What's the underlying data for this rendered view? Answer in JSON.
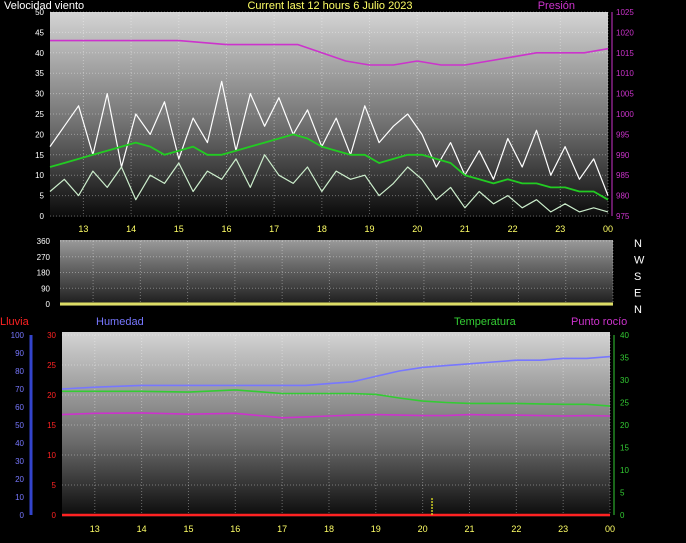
{
  "header": {
    "left_label": "Velocidad viento",
    "title": "Current last 12 hours 6 Julio 2023",
    "right_label": "Presión"
  },
  "colors": {
    "gust": "#ffffff",
    "wind_avg": "#22cc22",
    "wind_light": "#cceecc",
    "pressure": "#cc33cc",
    "direction_axis": "#dddd66",
    "humidity": "#7777ff",
    "temperature": "#33cc33",
    "dew_point": "#cc33cc",
    "rain": "#ff2222",
    "rain_axis": "#3344cc",
    "rain_event": "#cccc22",
    "xtick": "#ffff66"
  },
  "chart_data": [
    {
      "type": "line",
      "name": "wind-pressure",
      "x_ticks": [
        "13",
        "14",
        "15",
        "16",
        "17",
        "18",
        "19",
        "20",
        "21",
        "22",
        "23",
        "00"
      ],
      "y_left_ticks": [
        0,
        5,
        10,
        15,
        20,
        25,
        30,
        35,
        40,
        45,
        50
      ],
      "y_right_ticks": [
        975,
        980,
        985,
        990,
        995,
        1000,
        1005,
        1010,
        1015,
        1020,
        1025
      ],
      "ylim_left": [
        0,
        50
      ],
      "ylim_right": [
        975,
        1025
      ],
      "series": [
        {
          "key": "gust",
          "axis": "left",
          "x": [
            12.3,
            12.6,
            12.9,
            13.2,
            13.5,
            13.8,
            14.1,
            14.4,
            14.7,
            15.0,
            15.3,
            15.6,
            15.9,
            16.2,
            16.5,
            16.8,
            17.1,
            17.4,
            17.7,
            18.0,
            18.3,
            18.6,
            18.9,
            19.2,
            19.5,
            19.8,
            20.1,
            20.4,
            20.7,
            21.0,
            21.3,
            21.6,
            21.9,
            22.2,
            22.5,
            22.8,
            23.1,
            23.4,
            23.7,
            24.0
          ],
          "y": [
            17,
            22,
            27,
            15,
            30,
            12,
            25,
            20,
            28,
            14,
            24,
            18,
            33,
            16,
            30,
            22,
            29,
            20,
            26,
            17,
            24,
            15,
            27,
            18,
            22,
            25,
            20,
            12,
            18,
            10,
            16,
            9,
            19,
            12,
            21,
            10,
            17,
            9,
            14,
            5
          ]
        },
        {
          "key": "wind_avg",
          "axis": "left",
          "x": [
            12.3,
            12.6,
            12.9,
            13.2,
            13.5,
            13.8,
            14.1,
            14.4,
            14.7,
            15.0,
            15.3,
            15.6,
            15.9,
            16.2,
            16.5,
            16.8,
            17.1,
            17.4,
            17.7,
            18.0,
            18.3,
            18.6,
            18.9,
            19.2,
            19.5,
            19.8,
            20.1,
            20.4,
            20.7,
            21.0,
            21.3,
            21.6,
            21.9,
            22.2,
            22.5,
            22.8,
            23.1,
            23.4,
            23.7,
            24.0
          ],
          "y": [
            12,
            13,
            14,
            15,
            16,
            17,
            18,
            17,
            15,
            16,
            17,
            15,
            15,
            16,
            17,
            18,
            19,
            20,
            19,
            17,
            16,
            15,
            15,
            13,
            14,
            15,
            15,
            14,
            13,
            10,
            9,
            8,
            9,
            8,
            8,
            7,
            7,
            6,
            6,
            4
          ]
        },
        {
          "key": "wind_light",
          "axis": "left",
          "x": [
            12.3,
            12.6,
            12.9,
            13.2,
            13.5,
            13.8,
            14.1,
            14.4,
            14.7,
            15.0,
            15.3,
            15.6,
            15.9,
            16.2,
            16.5,
            16.8,
            17.1,
            17.4,
            17.7,
            18.0,
            18.3,
            18.6,
            18.9,
            19.2,
            19.5,
            19.8,
            20.1,
            20.4,
            20.7,
            21.0,
            21.3,
            21.6,
            21.9,
            22.2,
            22.5,
            22.8,
            23.1,
            23.4,
            23.7,
            24.0
          ],
          "y": [
            6,
            9,
            5,
            11,
            7,
            12,
            4,
            10,
            8,
            13,
            6,
            11,
            9,
            14,
            7,
            15,
            10,
            8,
            12,
            6,
            11,
            9,
            10,
            5,
            8,
            12,
            9,
            4,
            7,
            2,
            6,
            3,
            5,
            2,
            4,
            1,
            3,
            1,
            2,
            1
          ]
        },
        {
          "key": "pressure",
          "axis": "right",
          "x": [
            12.3,
            13.0,
            14.0,
            15.0,
            16.0,
            17.0,
            17.5,
            18.0,
            18.5,
            19.0,
            19.5,
            20.0,
            20.5,
            21.0,
            21.5,
            22.0,
            22.5,
            23.0,
            23.5,
            24.0
          ],
          "y": [
            1018,
            1018,
            1018,
            1018,
            1017,
            1017,
            1017,
            1015,
            1013,
            1012,
            1012,
            1013,
            1012,
            1012,
            1013,
            1014,
            1015,
            1015,
            1015,
            1016
          ]
        }
      ]
    },
    {
      "type": "line",
      "name": "wind-direction",
      "x_ticks": [
        "13",
        "14",
        "15",
        "16",
        "17",
        "18",
        "19",
        "20",
        "21",
        "22",
        "23",
        "00"
      ],
      "y_ticks": [
        0,
        90,
        180,
        270,
        360
      ],
      "ylim": [
        0,
        360
      ],
      "direction_labels": [
        "N",
        "W",
        "S",
        "E",
        "N"
      ],
      "series": [
        {
          "key": "direction",
          "x": [
            12.3,
            24.0
          ],
          "y": [
            0,
            0
          ]
        }
      ]
    },
    {
      "type": "line",
      "name": "temperature-humidity",
      "labels": {
        "rain": "Lluvia",
        "humidity": "Humedad",
        "temperature": "Temperatura",
        "dew_point": "Punto rocío"
      },
      "x_ticks": [
        "13",
        "14",
        "15",
        "16",
        "17",
        "18",
        "19",
        "20",
        "21",
        "22",
        "23",
        "00"
      ],
      "humidity_ticks": [
        0,
        10,
        20,
        30,
        40,
        50,
        60,
        70,
        80,
        90,
        100
      ],
      "rain_ticks": [
        0,
        5,
        10,
        15,
        20,
        25,
        30
      ],
      "temp_ticks": [
        0,
        5,
        10,
        15,
        20,
        25,
        30,
        35,
        40
      ],
      "ylim_humidity": [
        0,
        100
      ],
      "ylim_rain": [
        0,
        30
      ],
      "ylim_temp": [
        0,
        40
      ],
      "series": [
        {
          "key": "humidity",
          "axis": "humidity",
          "x": [
            12.3,
            13.0,
            14.0,
            15.0,
            16.0,
            17.0,
            17.5,
            18.0,
            18.5,
            19.0,
            19.5,
            20.0,
            20.5,
            21.0,
            21.5,
            22.0,
            22.5,
            23.0,
            23.5,
            24.0
          ],
          "y": [
            70,
            71,
            72,
            72,
            72,
            72,
            72,
            73,
            74,
            77,
            80,
            82,
            83,
            84,
            85,
            86,
            86,
            87,
            87,
            88
          ]
        },
        {
          "key": "temperature",
          "axis": "temp",
          "x": [
            12.3,
            13.0,
            14.0,
            15.0,
            16.0,
            17.0,
            17.5,
            18.0,
            18.5,
            19.0,
            19.5,
            20.0,
            20.5,
            21.0,
            21.5,
            22.0,
            22.5,
            23.0,
            23.5,
            24.0
          ],
          "y": [
            27.5,
            27.5,
            27.5,
            27.3,
            27.8,
            27.0,
            27.0,
            27.0,
            27.0,
            26.8,
            26.0,
            25.3,
            25.0,
            24.8,
            24.8,
            24.8,
            24.7,
            24.6,
            24.6,
            24.2
          ]
        },
        {
          "key": "dew_point",
          "axis": "temp",
          "x": [
            12.3,
            13.0,
            14.0,
            15.0,
            16.0,
            17.0,
            17.5,
            18.0,
            18.5,
            19.0,
            19.5,
            20.0,
            20.5,
            21.0,
            21.5,
            22.0,
            22.5,
            23.0,
            23.5,
            24.0
          ],
          "y": [
            22.3,
            22.6,
            22.7,
            22.4,
            22.6,
            21.6,
            21.8,
            22.0,
            22.2,
            22.3,
            22.2,
            22.1,
            22.1,
            22.3,
            22.2,
            22.2,
            22.1,
            22.0,
            22.1,
            22.0
          ]
        },
        {
          "key": "rain",
          "axis": "rain",
          "x": [
            12.3,
            24.0
          ],
          "y": [
            0,
            0
          ]
        }
      ],
      "rain_event": {
        "x": 20.2,
        "value": 3
      }
    }
  ]
}
